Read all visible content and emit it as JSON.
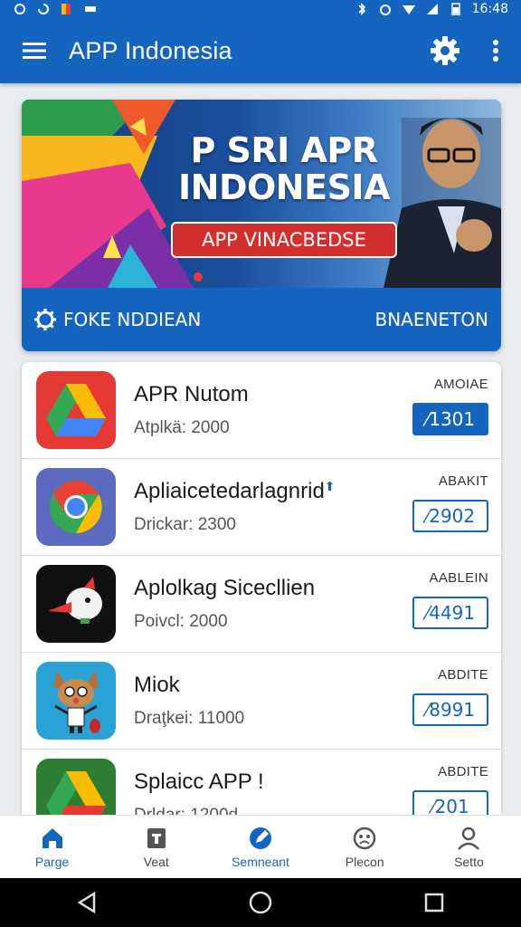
{
  "status_bar": {
    "time": "16:48"
  },
  "app_bar": {
    "title": "APP Indonesia"
  },
  "banner": {
    "headline_line1": "P SRI APR",
    "headline_line2": "INDONESIA",
    "badge": "APP VINACBEDSE",
    "footer_left": "FOKE NDDIEAN",
    "footer_right": "BNAENETON"
  },
  "apps": [
    {
      "name": "APR Nutom",
      "meta": "Atplkä: 2000",
      "tag": "AMOIAE",
      "price": "⁄1301",
      "filled": true,
      "icon": "drive-icon"
    },
    {
      "name": "Apliaicetedarlagnrid",
      "meta": "Drickar: 2300",
      "tag": "ABAKIT",
      "price": "⁄2902",
      "filled": false,
      "icon": "chrome-icon"
    },
    {
      "name": "Aplolkag Sicecllien",
      "meta": "Poivcl: 2000",
      "tag": "AABLEIN",
      "price": "⁄4491",
      "filled": false,
      "icon": "bird-icon"
    },
    {
      "name": "Miok",
      "meta": "Draţkei: 11000",
      "tag": "ABDITE",
      "price": "⁄8991",
      "filled": false,
      "icon": "cartoon-fox-icon"
    },
    {
      "name": "Splaicc APP !",
      "meta": "Drldar: 1200d",
      "tag": "ABDITE",
      "price": "⁄201",
      "filled": false,
      "icon": "drive-icon"
    }
  ],
  "bottom_nav": [
    {
      "label": "Parge",
      "icon": "home-icon",
      "active": true
    },
    {
      "label": "Veat",
      "icon": "news-icon",
      "active": false
    },
    {
      "label": "Semneant",
      "icon": "edit-icon",
      "active": true
    },
    {
      "label": "Plecon",
      "icon": "face-icon",
      "active": false
    },
    {
      "label": "Setto",
      "icon": "person-icon",
      "active": false
    }
  ],
  "colors": {
    "primary": "#1565c0",
    "badge_red": "#d32f2f",
    "background": "#e9ecef"
  }
}
